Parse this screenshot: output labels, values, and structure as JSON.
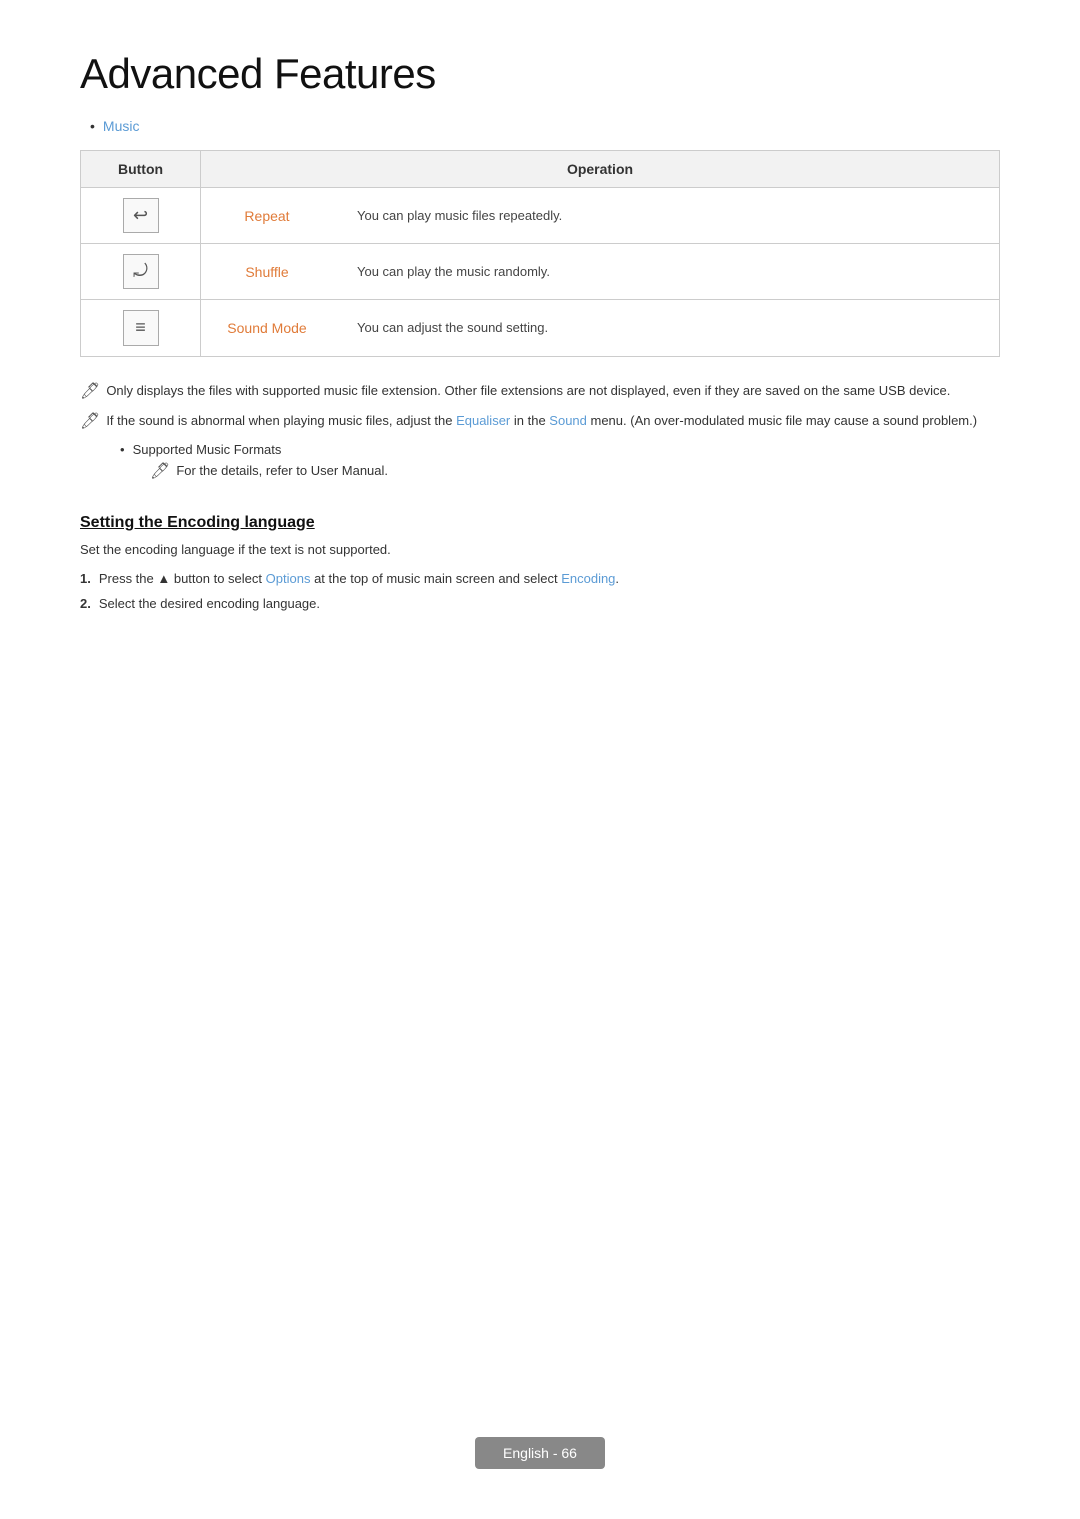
{
  "page": {
    "title": "Advanced Features",
    "footer": "English - 66"
  },
  "music_bullet": {
    "label": "Music",
    "color": "#5b9bd5"
  },
  "table": {
    "headers": [
      "Button",
      "Operation"
    ],
    "rows": [
      {
        "button_symbol": "↩",
        "op_label": "Repeat",
        "op_desc": "You can play music files repeatedly."
      },
      {
        "button_symbol": "⤾",
        "op_label": "Shuffle",
        "op_desc": "You can play the music randomly."
      },
      {
        "button_symbol": "≡",
        "op_label": "Sound Mode",
        "op_desc": "You can adjust the sound setting."
      }
    ]
  },
  "notes": [
    {
      "id": "note1",
      "text": "Only displays the files with supported music file extension. Other file extensions are not displayed, even if they are saved on the same USB device."
    },
    {
      "id": "note2",
      "text_before": "If the sound is abnormal when playing music files, adjust the ",
      "link1": "Equaliser",
      "text_mid": " in the ",
      "link2": "Sound",
      "text_after": " menu. (An over-modulated music file may cause a sound problem.)"
    }
  ],
  "supported_formats": {
    "label": "Supported Music Formats",
    "sub_note": "For the details, refer to User Manual."
  },
  "section": {
    "heading": "Setting the Encoding language",
    "desc": "Set the encoding language if the text is not supported.",
    "steps": [
      {
        "num": "1.",
        "text_before": "Press the ▲ button to select ",
        "link1": "Options",
        "text_mid": " at the top of music main screen and select ",
        "link2": "Encoding",
        "text_after": "."
      },
      {
        "num": "2.",
        "text": "Select the desired encoding language."
      }
    ]
  }
}
